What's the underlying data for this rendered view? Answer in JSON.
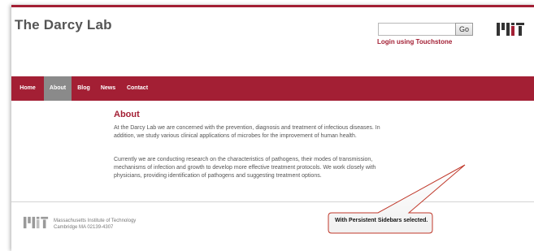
{
  "header": {
    "site_title": "The Darcy Lab",
    "search_value": "",
    "go_label": "Go",
    "login_label": "Login using Touchstone",
    "logo_icon": "mit-logo-icon"
  },
  "nav": {
    "items": [
      {
        "label": "Home",
        "active": false
      },
      {
        "label": "About",
        "active": true
      },
      {
        "label": "Blog",
        "active": false
      },
      {
        "label": "News",
        "active": false
      },
      {
        "label": "Contact",
        "active": false
      }
    ]
  },
  "main": {
    "heading": "About",
    "paragraphs": [
      "At the Darcy Lab we are concerned with the prevention, diagnosis and treatment of infectious diseases. In addition, we study various clinical applications of microbes for the improvement of human health.",
      "Currently we are conducting research on the characteristics of pathogens, their modes of transmission, mechanisms of infection and growth to develop more effective treatment protocols. We work closely with physicians, providing identification of pathogens and suggesting treatment options."
    ]
  },
  "footer": {
    "line1": "Massachusetts Institute of Technology",
    "line2": "Cambridge MA 02139-4307",
    "logo_icon": "mit-logo-icon"
  },
  "callout": {
    "text": "With Persistent Sidebars selected."
  },
  "colors": {
    "brand": "#a31f34",
    "active_tab": "#8a8a8a",
    "body_text": "#555555",
    "callout_fill": "#ffffff",
    "callout_border": "#c0392b"
  }
}
